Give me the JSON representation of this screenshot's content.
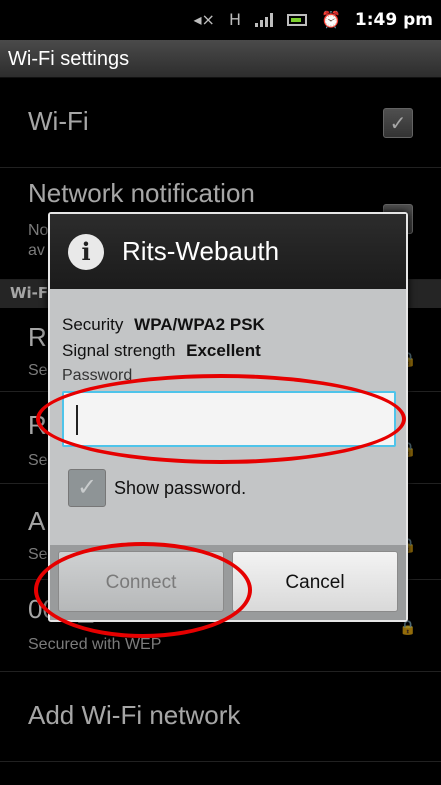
{
  "status_bar": {
    "time": "1:49 pm",
    "icons": [
      "mute-icon",
      "hspa-icon",
      "signal-icon",
      "battery-icon",
      "alarm-icon"
    ]
  },
  "title_bar": {
    "title": "Wi-Fi settings"
  },
  "settings": {
    "wifi_label": "Wi-Fi",
    "wifi_checked": true,
    "network_notification_label": "Network notification",
    "network_notification_sub": "No",
    "network_notification_sub2": "av",
    "section_label": "Wi-F",
    "networks": [
      {
        "name": "R",
        "sub": "Se"
      },
      {
        "name": "R",
        "sub": "Se"
      },
      {
        "name": "A",
        "sub": "Se"
      },
      {
        "name": "00/2_",
        "sub": "Secured with WEP"
      }
    ],
    "add_network_label": "Add Wi-Fi network"
  },
  "dialog": {
    "title": "Rits-Webauth",
    "security_label": "Security",
    "security_value": "WPA/WPA2 PSK",
    "signal_label": "Signal strength",
    "signal_value": "Excellent",
    "password_label": "Password",
    "password_value": "",
    "show_password_label": "Show password.",
    "show_password_checked": true,
    "connect_label": "Connect",
    "cancel_label": "Cancel"
  },
  "colors": {
    "annotation": "#e60000",
    "input_focus": "#4ec4ea",
    "battery": "#7ccf2e"
  }
}
